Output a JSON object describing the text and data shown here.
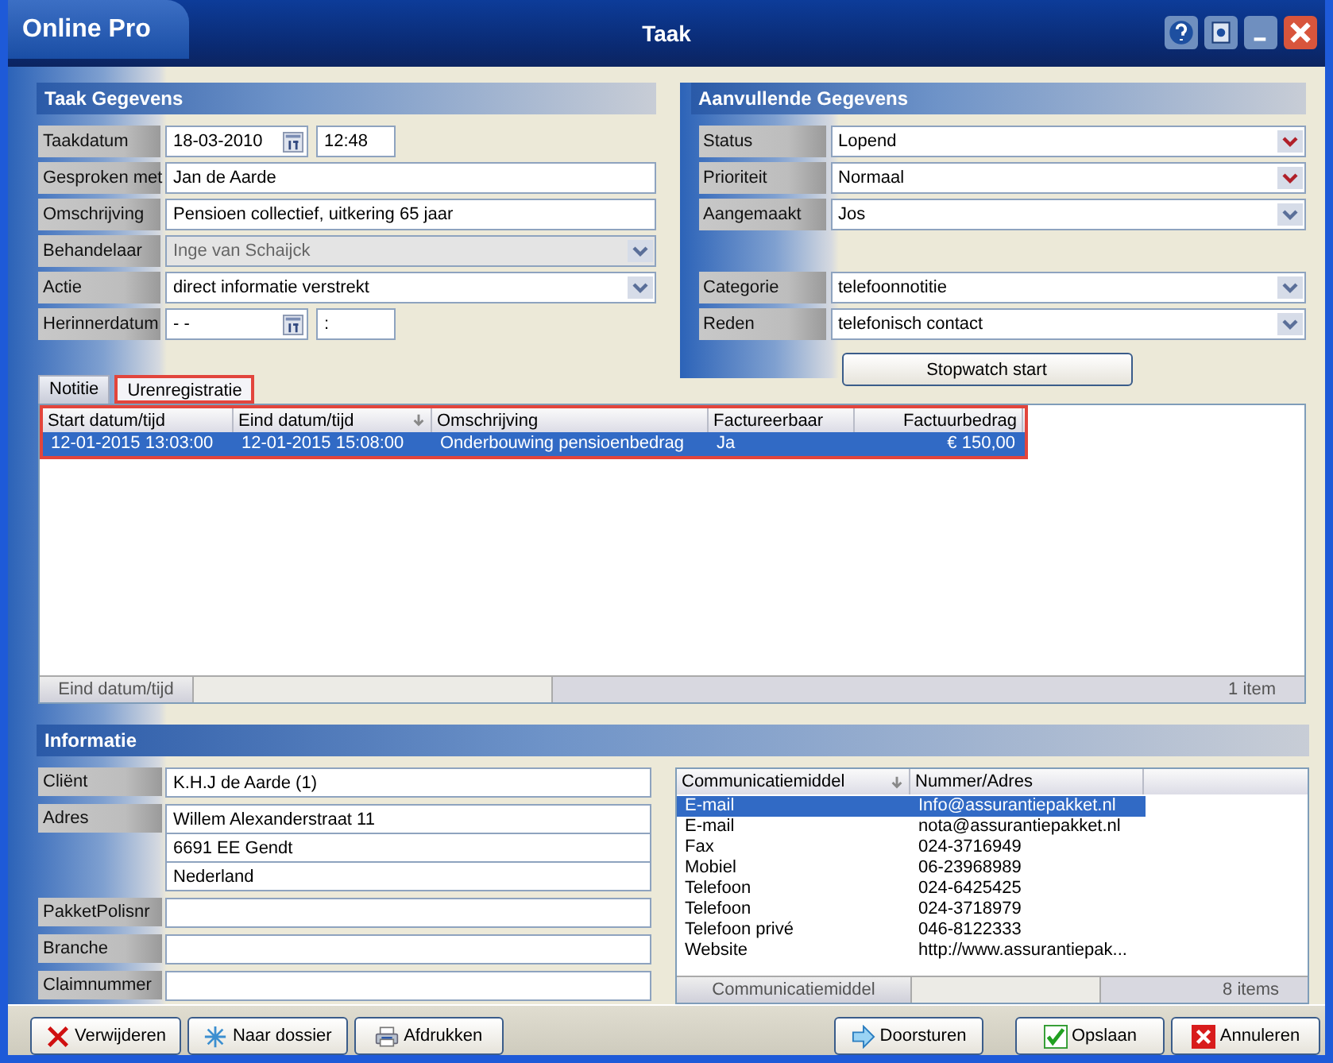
{
  "window": {
    "app_name": "Online Pro",
    "title": "Taak"
  },
  "title_buttons": [
    {
      "kind": "help"
    },
    {
      "kind": "restore"
    },
    {
      "kind": "minimize"
    },
    {
      "kind": "close"
    }
  ],
  "taak_gegevens": {
    "title": "Taak Gegevens",
    "fields": [
      {
        "label": "Taakdatum",
        "kind": "datetime",
        "value": "18-03-2010",
        "time": "12:48"
      },
      {
        "label": "Gesproken met",
        "kind": "text",
        "value": "Jan de Aarde"
      },
      {
        "label": "Omschrijving",
        "kind": "text",
        "value": "Pensioen collectief, uitkering 65 jaar"
      },
      {
        "label": "Behandelaar",
        "kind": "select",
        "value": "Inge van Schaijck",
        "disabled": true
      },
      {
        "label": "Actie",
        "kind": "select",
        "value": "direct informatie verstrekt",
        "disabled": false
      },
      {
        "label": "Herinnerdatum",
        "kind": "datetime",
        "value": "- -",
        "time": ":"
      }
    ]
  },
  "aanvullende_gegevens": {
    "title": "Aanvullende Gegevens",
    "groups": [
      [
        {
          "label": "Status",
          "value": "Lopend",
          "required": true
        },
        {
          "label": "Prioriteit",
          "value": "Normaal",
          "required": true
        },
        {
          "label": "Aangemaakt",
          "value": "Jos",
          "required": false
        }
      ],
      [
        {
          "label": "Categorie",
          "value": "telefoonnotitie",
          "required": false
        },
        {
          "label": "Reden",
          "value": "telefonisch contact",
          "required": false
        }
      ]
    ],
    "button": "Stopwatch start"
  },
  "tabs": [
    {
      "label": "Notitie",
      "selected": false,
      "highlighted": false
    },
    {
      "label": "Urenregistratie",
      "selected": true,
      "highlighted": true
    }
  ],
  "hours_table": {
    "highlighted": true,
    "columns": [
      {
        "label": "Start datum/tijd",
        "sorted": false
      },
      {
        "label": "Eind datum/tijd",
        "sorted": true
      },
      {
        "label": "Omschrijving",
        "sorted": false
      },
      {
        "label": "Factureerbaar",
        "sorted": false
      },
      {
        "label": "Factuurbedrag",
        "sorted": false
      }
    ],
    "rows": [
      {
        "selected": true,
        "cells": [
          "12-01-2015 13:03:00",
          "12-01-2015 15:08:00",
          "Onderbouwing pensioenbedrag",
          "Ja",
          "€ 150,00"
        ]
      }
    ],
    "footer": {
      "group": "Eind datum/tijd",
      "count": "1 item"
    }
  },
  "informatie": {
    "title": "Informatie",
    "fields": [
      {
        "label": "Cliënt",
        "lines": [
          "K.H.J de Aarde (1)"
        ]
      },
      {
        "label": "Adres",
        "lines": [
          "Willem Alexanderstraat 11",
          "6691 EE Gendt",
          "Nederland"
        ]
      },
      {
        "label": "PakketPolisnr"
      },
      {
        "label": "Branche"
      },
      {
        "label": "Claimnummer"
      }
    ]
  },
  "communication_table": {
    "columns": [
      {
        "label": "Communicatiemiddel",
        "sorted": true
      },
      {
        "label": "Nummer/Adres",
        "sorted": false
      }
    ],
    "rows": [
      {
        "selected": true,
        "cells": [
          "E-mail",
          "Info@assurantiepakket.nl"
        ]
      },
      {
        "selected": false,
        "cells": [
          "E-mail",
          "nota@assurantiepakket.nl"
        ]
      },
      {
        "selected": false,
        "cells": [
          "Fax",
          "024-3716949"
        ]
      },
      {
        "selected": false,
        "cells": [
          "Mobiel",
          "06-23968989"
        ]
      },
      {
        "selected": false,
        "cells": [
          "Telefoon",
          "024-6425425"
        ]
      },
      {
        "selected": false,
        "cells": [
          "Telefoon",
          "024-3718979"
        ]
      },
      {
        "selected": false,
        "cells": [
          "Telefoon privé",
          "046-8122333"
        ]
      },
      {
        "selected": false,
        "cells": [
          "Website",
          "http://www.assurantiepak..."
        ]
      }
    ],
    "footer": {
      "group": "Communicatiemiddel",
      "count": "8 items"
    }
  },
  "buttons_left": [
    {
      "label": "Verwijderen",
      "kind": "delete"
    },
    {
      "label": "Naar dossier",
      "kind": "dossier"
    },
    {
      "label": "Afdrukken",
      "kind": "print"
    }
  ],
  "buttons_right": [
    {
      "label": "Doorsturen",
      "kind": "forward"
    },
    {
      "label": "Opslaan",
      "kind": "save"
    },
    {
      "label": "Annuleren",
      "kind": "cancel"
    }
  ]
}
